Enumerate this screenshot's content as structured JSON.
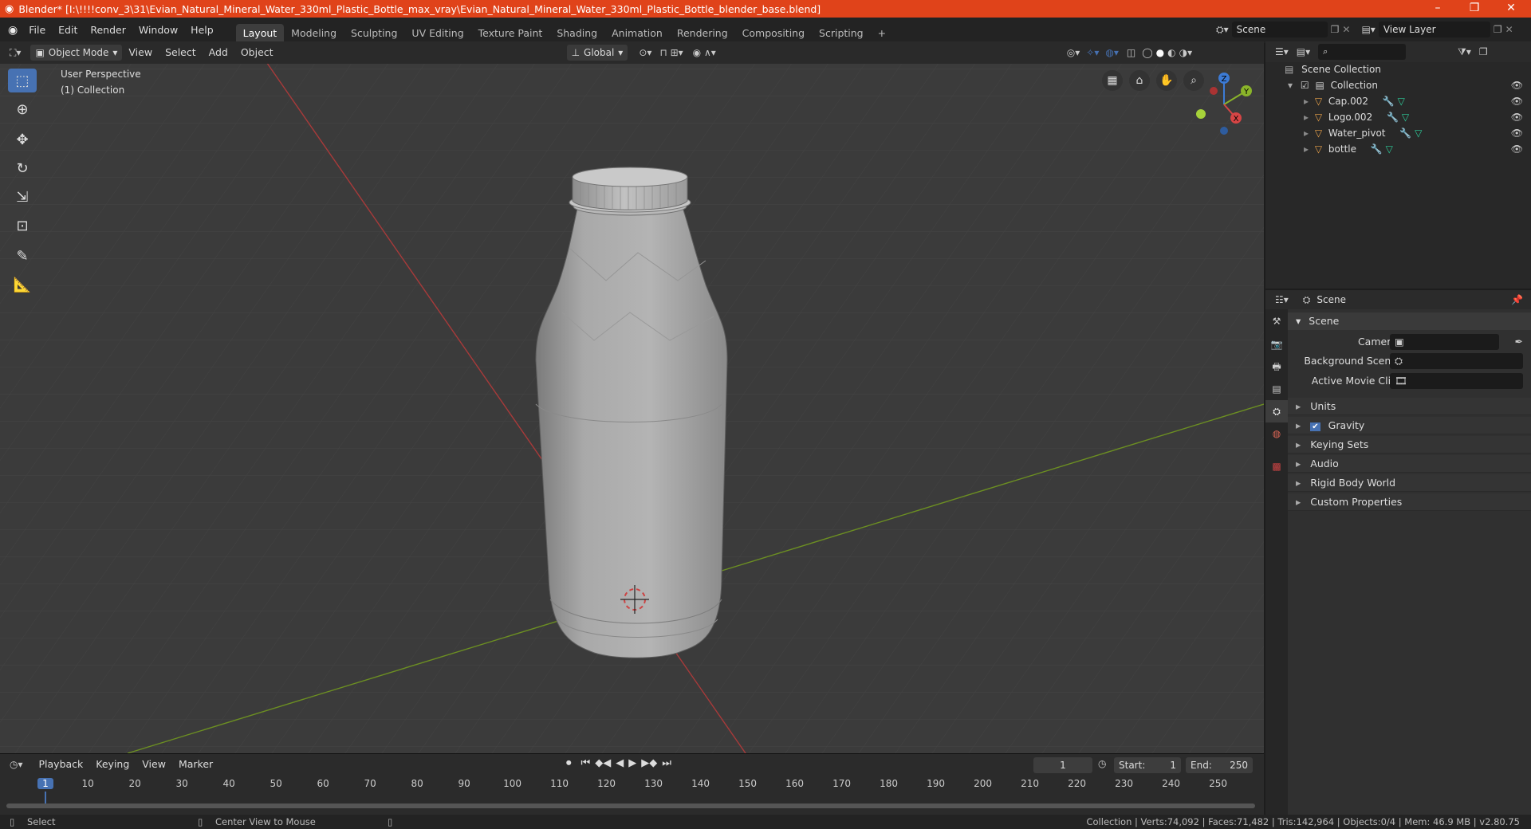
{
  "window": {
    "title": "Blender* [I:\\!!!!conv_3\\31\\Evian_Natural_Mineral_Water_330ml_Plastic_Bottle_max_vray\\Evian_Natural_Mineral_Water_330ml_Plastic_Bottle_blender_base.blend]",
    "minimize": "–",
    "maximize": "❐",
    "close": "✕"
  },
  "menu": [
    "File",
    "Edit",
    "Render",
    "Window",
    "Help"
  ],
  "workspaces": [
    "Layout",
    "Modeling",
    "Sculpting",
    "UV Editing",
    "Texture Paint",
    "Shading",
    "Animation",
    "Rendering",
    "Compositing",
    "Scripting"
  ],
  "workspace_add": "+",
  "scene": {
    "label": "Scene",
    "viewlayer": "View Layer"
  },
  "viewport_header": {
    "mode": "Object Mode",
    "menus": [
      "View",
      "Select",
      "Add",
      "Object"
    ],
    "orientation": "Global"
  },
  "viewport": {
    "perspective": "User Perspective",
    "collection": "(1) Collection",
    "gizmo": {
      "x": "X",
      "y": "Y",
      "z": "Z"
    }
  },
  "outliner": {
    "root": "Scene Collection",
    "collection": "Collection",
    "items": [
      "Cap.002",
      "Logo.002",
      "Water_pivot",
      "bottle"
    ]
  },
  "properties": {
    "header": "Scene",
    "panel": "Scene",
    "fields": [
      {
        "label": "Camera",
        "value": ""
      },
      {
        "label": "Background Scene",
        "value": ""
      },
      {
        "label": "Active Movie Clip",
        "value": ""
      }
    ],
    "sections": [
      "Units",
      "Gravity",
      "Keying Sets",
      "Audio",
      "Rigid Body World",
      "Custom Properties"
    ]
  },
  "timeline": {
    "menus": [
      "Playback",
      "Keying",
      "View",
      "Marker"
    ],
    "current_frame": "1",
    "start_label": "Start:",
    "start": "1",
    "end_label": "End:",
    "end": "250",
    "ticks": [
      "1",
      "10",
      "20",
      "30",
      "40",
      "50",
      "60",
      "70",
      "80",
      "90",
      "100",
      "110",
      "120",
      "130",
      "140",
      "150",
      "160",
      "170",
      "180",
      "190",
      "200",
      "210",
      "220",
      "230",
      "240",
      "250"
    ]
  },
  "status": {
    "left": "Select",
    "middle": "Center View to Mouse",
    "right": "Collection | Verts:74,092 | Faces:71,482 | Tris:142,964 | Objects:0/4 | Mem: 46.9 MB | v2.80.75"
  },
  "colors": {
    "accent": "#4772b3",
    "titlebar": "#e0431a",
    "x_axis": "#c23a3a",
    "y_axis": "#7a9c2a"
  }
}
